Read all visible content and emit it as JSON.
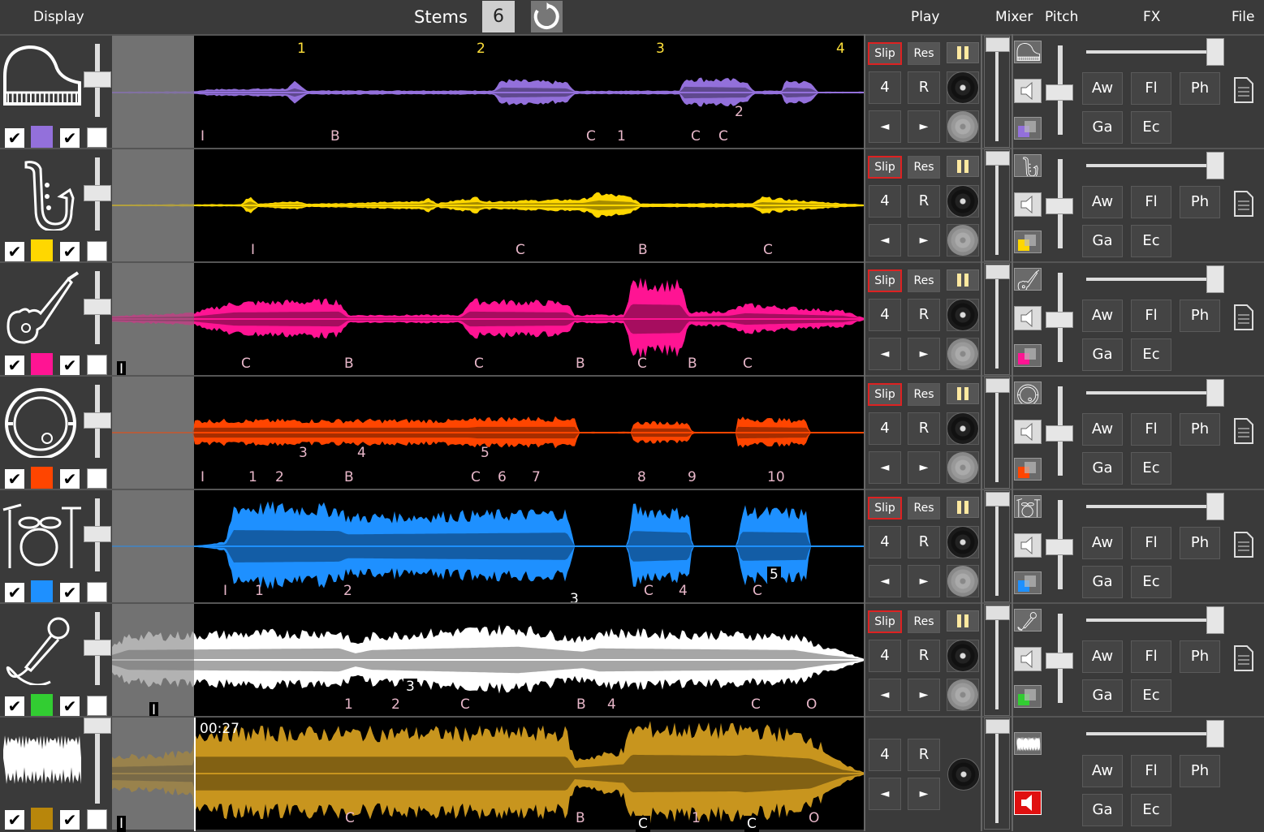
{
  "header": {
    "display_label": "Display",
    "stems_label": "Stems",
    "stems_count": "6",
    "play_label": "Play",
    "mixer_label": "Mixer",
    "pitch_label": "Pitch",
    "fx_label": "FX",
    "file_label": "File"
  },
  "controls": {
    "slip": "Slip",
    "res": "Res",
    "four": "4",
    "r": "R",
    "left_arrow": "◄",
    "right_arrow": "►",
    "aw": "Aw",
    "fl": "Fl",
    "ph": "Ph",
    "ga": "Ga",
    "ec": "Ec"
  },
  "timecode": "00:27",
  "bar_numbers": [
    "1",
    "2",
    "3",
    "4"
  ],
  "tracks": [
    {
      "name": "piano",
      "icon": "piano-icon",
      "color": "#9370db",
      "wave_color": "#9370db",
      "active": true,
      "markers": [
        "I",
        "B",
        "C",
        "1",
        "C",
        "C",
        "2"
      ]
    },
    {
      "name": "saxophone",
      "icon": "saxophone-icon",
      "color": "#ffd700",
      "wave_color": "#ffd700",
      "active": true,
      "markers": [
        "I",
        "C",
        "B",
        "C"
      ]
    },
    {
      "name": "guitar",
      "icon": "guitar-icon",
      "color": "#ff1493",
      "wave_color": "#ff1493",
      "active": true,
      "markers": [
        "I",
        "C",
        "B",
        "C",
        "B",
        "C",
        "B",
        "C"
      ]
    },
    {
      "name": "bass-drum",
      "icon": "bass-drum-icon",
      "color": "#ff4500",
      "wave_color": "#ff4500",
      "active": true,
      "markers": [
        "I",
        "1",
        "2",
        "3",
        "4",
        "B",
        "5",
        "C",
        "6",
        "7",
        "8",
        "9",
        "10"
      ]
    },
    {
      "name": "drums",
      "icon": "drum-kit-icon",
      "color": "#1e90ff",
      "wave_color": "#1e90ff",
      "active": true,
      "markers": [
        "I",
        "1",
        "2",
        "3",
        "C",
        "4",
        "5",
        "C"
      ]
    },
    {
      "name": "vocals",
      "icon": "microphone-icon",
      "color": "#32cd32",
      "wave_color": "#ffffff",
      "active": true,
      "markers": [
        "I",
        "3",
        "1",
        "2",
        "C",
        "B",
        "4",
        "C",
        "O"
      ]
    },
    {
      "name": "mix",
      "icon": "waveform-icon",
      "color": "#b8860b",
      "wave_color": "#c8951e",
      "active": false,
      "markers": [
        "I",
        "C",
        "B",
        "C",
        "1",
        "C",
        "O"
      ]
    }
  ]
}
